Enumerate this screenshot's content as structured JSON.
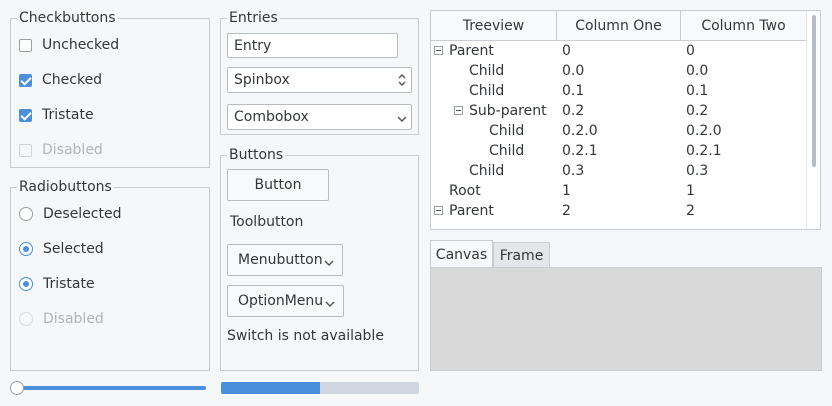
{
  "checkbuttons": {
    "title": "Checkbuttons",
    "items": [
      {
        "label": "Unchecked",
        "state": "unchecked"
      },
      {
        "label": "Checked",
        "state": "checked"
      },
      {
        "label": "Tristate",
        "state": "checked"
      },
      {
        "label": "Disabled",
        "state": "disabled"
      }
    ]
  },
  "radiobuttons": {
    "title": "Radiobuttons",
    "items": [
      {
        "label": "Deselected",
        "state": "off"
      },
      {
        "label": "Selected",
        "state": "on"
      },
      {
        "label": "Tristate",
        "state": "on"
      },
      {
        "label": "Disabled",
        "state": "disabled"
      }
    ]
  },
  "entries": {
    "title": "Entries",
    "entry_value": "Entry",
    "spinbox_value": "Spinbox",
    "combobox_value": "Combobox"
  },
  "buttons": {
    "title": "Buttons",
    "button_label": "Button",
    "toolbutton_label": "Toolbutton",
    "menubutton_label": "Menubutton",
    "optionmenu_label": "OptionMenu",
    "switch_note": "Switch is not available"
  },
  "scale": {
    "value": 0.0
  },
  "progress": {
    "value": 0.5
  },
  "treeview": {
    "columns": [
      "Treeview",
      "Column One",
      "Column Two"
    ],
    "rows": [
      {
        "name": "Parent",
        "c1": "0",
        "c2": "0",
        "indent": 0,
        "toggle": true
      },
      {
        "name": "Child",
        "c1": "0.0",
        "c2": "0.0",
        "indent": 1,
        "toggle": false
      },
      {
        "name": "Child",
        "c1": "0.1",
        "c2": "0.1",
        "indent": 1,
        "toggle": false
      },
      {
        "name": "Sub-parent",
        "c1": "0.2",
        "c2": "0.2",
        "indent": 1,
        "toggle": true
      },
      {
        "name": "Child",
        "c1": "0.2.0",
        "c2": "0.2.0",
        "indent": 2,
        "toggle": false
      },
      {
        "name": "Child",
        "c1": "0.2.1",
        "c2": "0.2.1",
        "indent": 2,
        "toggle": false
      },
      {
        "name": "Child",
        "c1": "0.3",
        "c2": "0.3",
        "indent": 1,
        "toggle": false
      },
      {
        "name": "Root",
        "c1": "1",
        "c2": "1",
        "indent": 0,
        "toggle": false
      },
      {
        "name": "Parent",
        "c1": "2",
        "c2": "2",
        "indent": 0,
        "toggle": true
      }
    ]
  },
  "notebook": {
    "tabs": [
      {
        "label": "Canvas",
        "active": true
      },
      {
        "label": "Frame",
        "active": false
      }
    ]
  },
  "colors": {
    "accent": "#4a8fdc",
    "canvas": "#d9d9d9",
    "background": "#f6f7f9"
  }
}
